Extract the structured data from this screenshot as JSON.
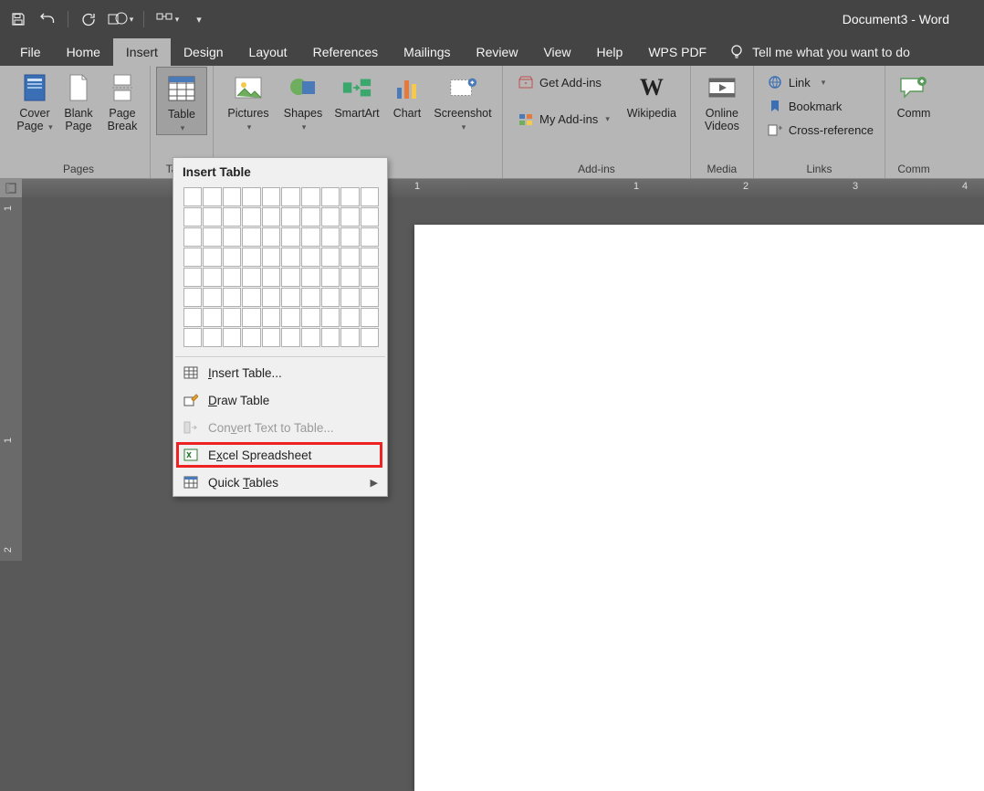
{
  "window": {
    "title": "Document3  -  Word"
  },
  "tabs": {
    "file": "File",
    "home": "Home",
    "insert": "Insert",
    "design": "Design",
    "layout": "Layout",
    "references": "References",
    "mailings": "Mailings",
    "review": "Review",
    "view": "View",
    "help": "Help",
    "wpspdf": "WPS PDF",
    "tellme": "Tell me what you want to do"
  },
  "ribbon": {
    "pages": {
      "label": "Pages",
      "cover": "Cover\nPage",
      "blank": "Blank\nPage",
      "break": "Page\nBreak"
    },
    "tables": {
      "label": "Tables",
      "table": "Table"
    },
    "illustrations": {
      "pictures": "Pictures",
      "shapes": "Shapes",
      "smartart": "SmartArt",
      "chart": "Chart",
      "screenshot": "Screenshot"
    },
    "addins": {
      "label": "Add-ins",
      "get": "Get Add-ins",
      "my": "My Add-ins",
      "wikipedia": "Wikipedia"
    },
    "media": {
      "label": "Media",
      "online": "Online\nVideos"
    },
    "links": {
      "label": "Links",
      "link": "Link",
      "bookmark": "Bookmark",
      "crossref": "Cross-reference"
    },
    "comments": {
      "label": "Comm",
      "btn": "Comm"
    }
  },
  "dropdown": {
    "title": "Insert Table",
    "grid": {
      "rows": 8,
      "cols": 10
    },
    "items": {
      "insert": "nsert Table...",
      "draw": "raw Table",
      "convert": "Con",
      "convert2": "ert Text to Table...",
      "excel": "E",
      "excel2": "cel Spreadsheet",
      "quick": "Quick ",
      "quick2": "ables"
    }
  },
  "ruler": {
    "h": [
      "1",
      "1",
      "2",
      "3",
      "4"
    ],
    "v": [
      "1",
      "1",
      "2"
    ]
  }
}
